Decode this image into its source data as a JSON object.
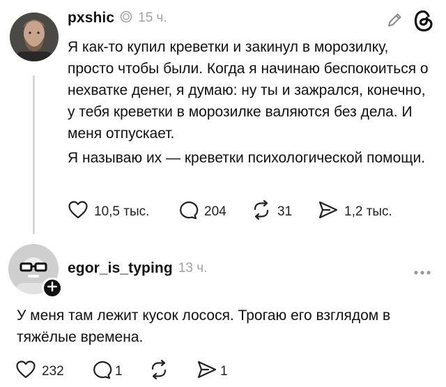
{
  "post": {
    "username": "pxshic",
    "time": "15 ч.",
    "text_paragraphs": [
      "Я как-то купил  креветки и закинул в морозилку, просто чтобы были. Когда я начинаю беспокоиться о нехватке денег, я думаю: ну ты и зажрался, конечно, у тебя креветки в морозилке валяются без дела. И меня отпускает.",
      "Я называю их — креветки психологической помощи."
    ],
    "actions": {
      "likes": "10,5 тыс.",
      "comments": "204",
      "reposts": "31",
      "shares": "1,2 тыс."
    }
  },
  "reply": {
    "username": "egor_is_typing",
    "time": "13 ч.",
    "text": "У меня там лежит кусок лосося. Трогаю его взглядом в тяжёлые времена.",
    "actions": {
      "likes": "232",
      "comments": "1",
      "shares": "1"
    }
  },
  "icons": {
    "header_right": [
      "edit-icon",
      "threads-logo-icon"
    ],
    "post_actions": [
      "heart-icon",
      "comment-icon",
      "repost-icon",
      "share-icon"
    ],
    "reply_more": "more-icon"
  },
  "colors": {
    "text": "#111111",
    "muted": "#a3a3a3",
    "line": "#d6d6d6"
  }
}
